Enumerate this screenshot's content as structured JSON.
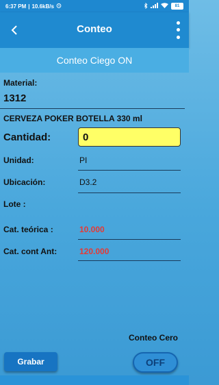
{
  "status_bar": {
    "time": "6:37 PM",
    "speed": "10.6kB/s",
    "battery": "81"
  },
  "app_bar": {
    "title": "Conteo"
  },
  "banner": {
    "text": "Conteo Ciego ON"
  },
  "form": {
    "material_label": "Material:",
    "material_value": "1312",
    "description": "CERVEZA POKER BOTELLA 330 ml",
    "quantity_label": "Cantidad:",
    "quantity_value": "0",
    "unit_label": "Unidad:",
    "unit_value": "PI",
    "location_label": "Ubicación:",
    "location_value": "D3.2",
    "lot_label": "Lote :",
    "lot_value": "",
    "theoretical_label": "Cat. teórica :",
    "theoretical_value": "10.000",
    "previous_count_label": "Cat. cont Ant:",
    "previous_count_value": "120.000"
  },
  "footer": {
    "zero_count_label": "Conteo Cero",
    "save_label": "Grabar",
    "toggle_label": "OFF"
  },
  "colors": {
    "app_bar": "#1f8ad0",
    "banner": "#4aaee3",
    "input_highlight": "#ffff66",
    "alert_value": "#e53935"
  }
}
